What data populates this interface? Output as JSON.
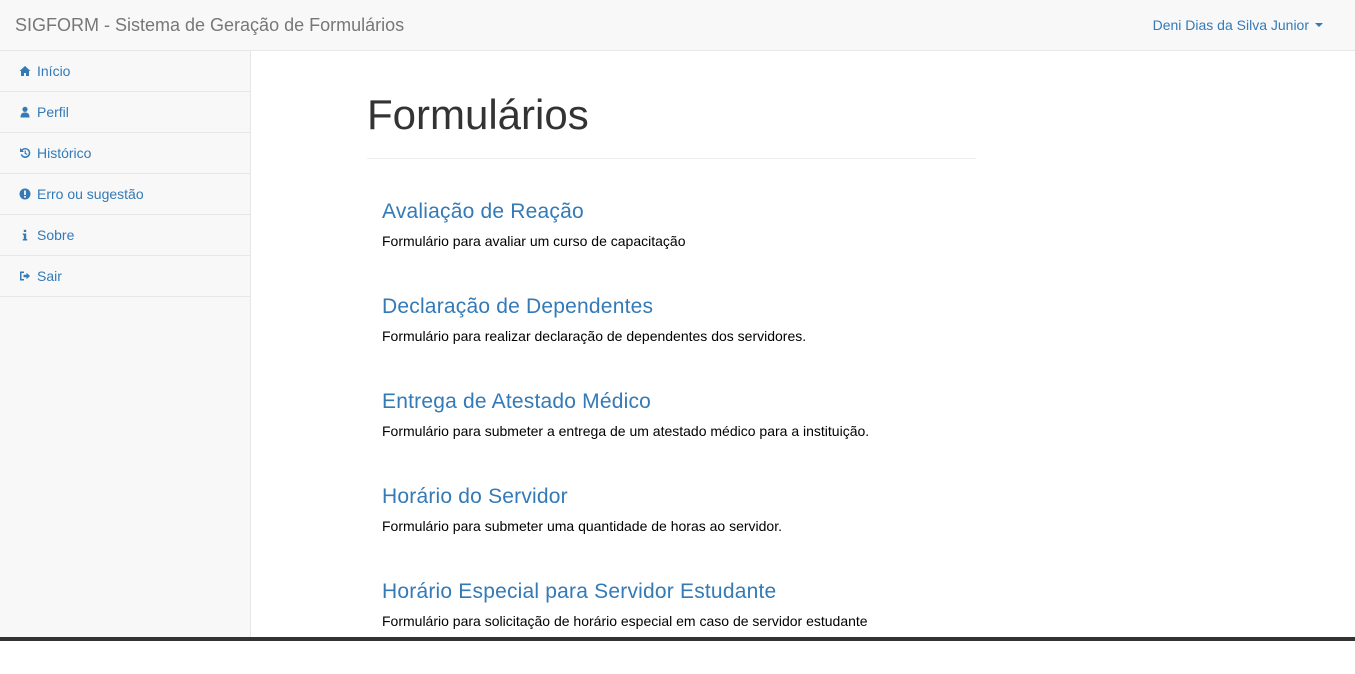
{
  "navbar": {
    "brand": "SIGFORM - Sistema de Geração de Formulários",
    "user": "Deni Dias da Silva Junior"
  },
  "sidebar": {
    "items": [
      {
        "label": "Início",
        "icon": "home-icon"
      },
      {
        "label": "Perfil",
        "icon": "user-icon"
      },
      {
        "label": "Histórico",
        "icon": "history-icon"
      },
      {
        "label": "Erro ou sugestão",
        "icon": "exclamation-icon"
      },
      {
        "label": "Sobre",
        "icon": "info-icon"
      },
      {
        "label": "Sair",
        "icon": "logout-icon"
      }
    ]
  },
  "main": {
    "title": "Formulários",
    "forms": [
      {
        "title": "Avaliação de Reação",
        "description": "Formulário para avaliar um curso de capacitação"
      },
      {
        "title": "Declaração de Dependentes",
        "description": "Formulário para realizar declaração de dependentes dos servidores."
      },
      {
        "title": "Entrega de Atestado Médico",
        "description": "Formulário para submeter a entrega de um atestado médico para a instituição."
      },
      {
        "title": "Horário do Servidor",
        "description": "Formulário para submeter uma quantidade de horas ao servidor."
      },
      {
        "title": "Horário Especial para Servidor Estudante",
        "description": "Formulário para solicitação de horário especial em caso de servidor estudante"
      }
    ]
  },
  "colors": {
    "link": "#337ab7",
    "navbar_bg": "#f8f8f8",
    "brand_text": "#777777"
  }
}
